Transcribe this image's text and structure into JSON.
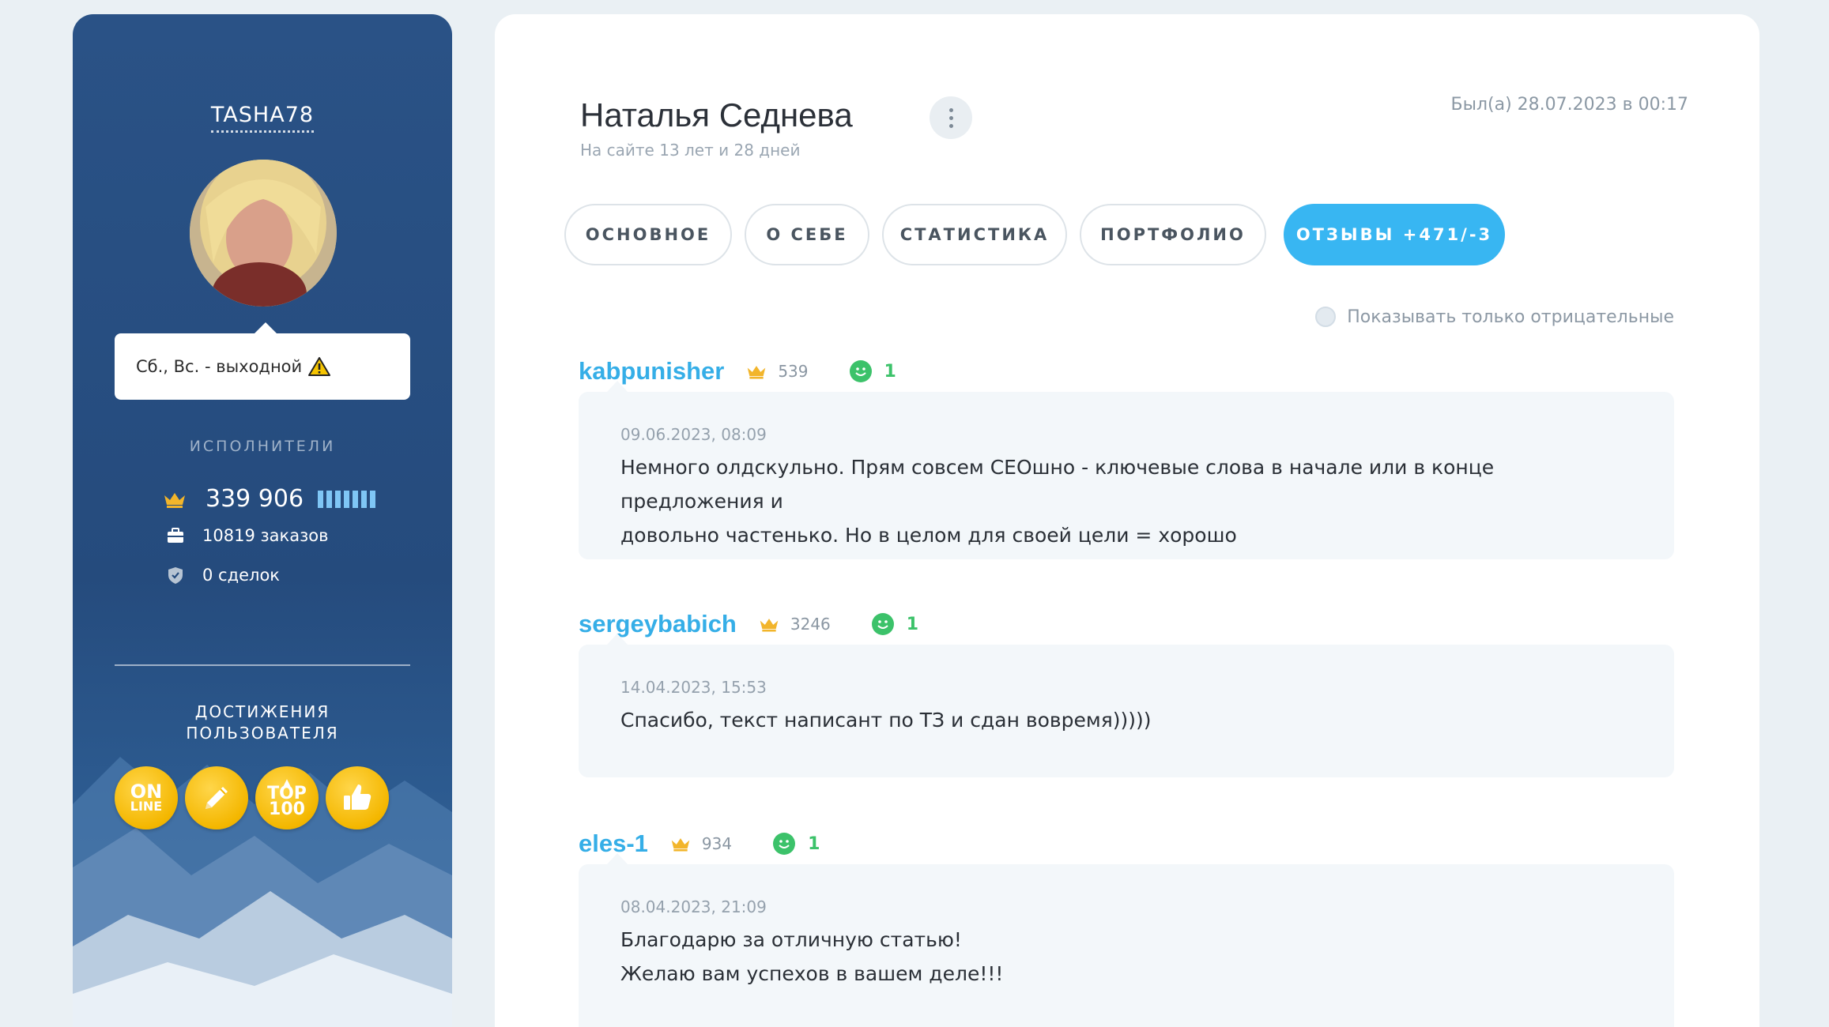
{
  "sidebar": {
    "username": "TASHA78",
    "status_note": "Сб., Вс. - выходной",
    "role_label": "ИСПОЛНИТЕЛИ",
    "rating": "339 906",
    "orders": "10819 заказов",
    "deals": "0 сделок",
    "achievements_title_line1": "ДОСТИЖЕНИЯ",
    "achievements_title_line2": "ПОЛЬЗОВАТЕЛЯ",
    "badges": [
      {
        "icon": "online-badge-icon",
        "line1": "ON",
        "line2": "LINE"
      },
      {
        "icon": "pencil-badge-icon"
      },
      {
        "icon": "top100-badge-icon",
        "line1": "TOP",
        "line2": "100"
      },
      {
        "icon": "thumbs-up-badge-icon"
      }
    ]
  },
  "profile": {
    "name": "Наталья Седнева",
    "since": "На сайте 13 лет и 28 дней",
    "last_seen": "Был(а) 28.07.2023 в 00:17"
  },
  "tabs": [
    {
      "label": "ОСНОВНОЕ",
      "active": false
    },
    {
      "label": "О СЕБЕ",
      "active": false
    },
    {
      "label": "СТАТИСТИКА",
      "active": false
    },
    {
      "label": "ПОРТФОЛИО",
      "active": false
    },
    {
      "label": "ОТЗЫВЫ +471/-3",
      "active": true
    }
  ],
  "filter": {
    "negative_only_label": "Показывать только отрицательные"
  },
  "reviews": [
    {
      "author": "kabpunisher",
      "rating": "539",
      "positive": "1",
      "date": "09.06.2023, 08:09",
      "text_line1": "Немного олдскульно. Прям совсем СЕОшно - ключевые слова в начале или в конце предложения и",
      "text_line2": "довольно частенько. Но в целом для своей цели = хорошо"
    },
    {
      "author": "sergeybabich",
      "rating": "3246",
      "positive": "1",
      "date": "14.04.2023, 15:53",
      "text_line1": "Спасибо, текст написант по ТЗ и сдан вовремя)))))"
    },
    {
      "author": "eles-1",
      "rating": "934",
      "positive": "1",
      "date": "08.04.2023, 21:09",
      "text_line1": "Благодарю за отличную статью!",
      "text_line2": "Желаю вам успехов в вашем деле!!!"
    }
  ],
  "colors": {
    "accent": "#38b6f2",
    "author": "#35aee7",
    "positive": "#3cc26a",
    "sidebar": "#254b7d",
    "badge": "#f4b700"
  }
}
